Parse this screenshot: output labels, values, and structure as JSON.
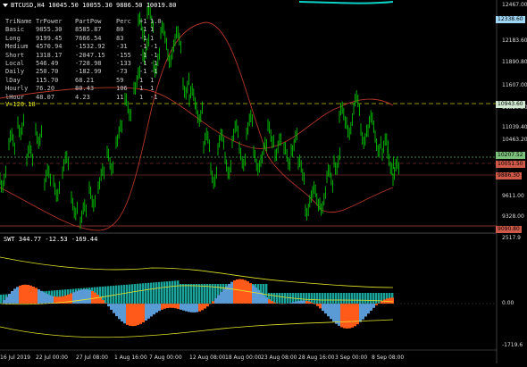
{
  "header": {
    "symbol_info": "BTCUSD,H4  10045.50 10055.30 9886.50 10019.80"
  },
  "table": {
    "headers": [
      "TriName",
      "TrPower",
      "PartPow",
      "Perc",
      "+1",
      "1.0"
    ],
    "rows": [
      [
        "Basic",
        "9855.30",
        "8585.87",
        "80",
        "-1",
        "1"
      ],
      [
        "Long",
        "9199.45",
        "7666.54",
        "83",
        "-1",
        "1"
      ],
      [
        "Medium",
        "4570.94",
        "-1532.92",
        "-31",
        "-1",
        "-1"
      ],
      [
        "Short",
        "1318.17",
        "-2047.15",
        "-155",
        "-1",
        "-1"
      ],
      [
        "Local",
        "546.49",
        "-728.98",
        "-133",
        "-1",
        "-1"
      ],
      [
        "Daily",
        "250.70",
        "-182.99",
        "-73",
        "-1",
        "-1"
      ],
      [
        "lDay",
        "115.70",
        "68.21",
        "59",
        "1",
        "1"
      ],
      [
        "Hourly",
        "76.20",
        "80.43",
        "106",
        "1",
        "1"
      ],
      [
        "lHour",
        "48.07",
        "4.23",
        "11",
        "1",
        "-1"
      ]
    ],
    "vline_label": "V=120.18"
  },
  "price_axis": {
    "labels": [
      "12467.00",
      "12183.60",
      "11890.80",
      "11607.00",
      "11323.20",
      "11039.40",
      "10463.20",
      "9611.00",
      "9328.00"
    ]
  },
  "price_tags": [
    {
      "text": "12338.60",
      "color": "#9fd7f6"
    },
    {
      "text": "10943.60",
      "color": "#cfe8cf"
    },
    {
      "text": "10207.52",
      "color": "#7cc27c"
    },
    {
      "text": "10051.50",
      "color": "#d05a4a"
    },
    {
      "text": "9886.30",
      "color": "#d05a4a"
    },
    {
      "text": "9090.80",
      "color": "#d05a4a"
    }
  ],
  "indicator": {
    "label": "SWT 344.77 -12.53 -169.44",
    "axis_labels": [
      "2517.9",
      "0.00",
      "-1719.6"
    ]
  },
  "time_axis": {
    "labels": [
      "16 Jul 2019",
      "22 Jul 00:00",
      "27 Jul 08:00",
      "1 Aug 16:00",
      "7 Aug 00:00",
      "12 Aug 08:00",
      "18 Aug 00:00",
      "23 Aug 08:00",
      "28 Aug 16:00",
      "3 Sep 00:00",
      "8 Sep 08:00"
    ]
  },
  "colors": {
    "candles": "#00c400",
    "upper_band": "#0bd3c8",
    "lower_band": "#b5372a",
    "hist_blue": "#5b9bd5",
    "hist_orange": "#ff5a1a",
    "hist_teal": "#1aa39b",
    "yellow": "#e6e62a"
  }
}
